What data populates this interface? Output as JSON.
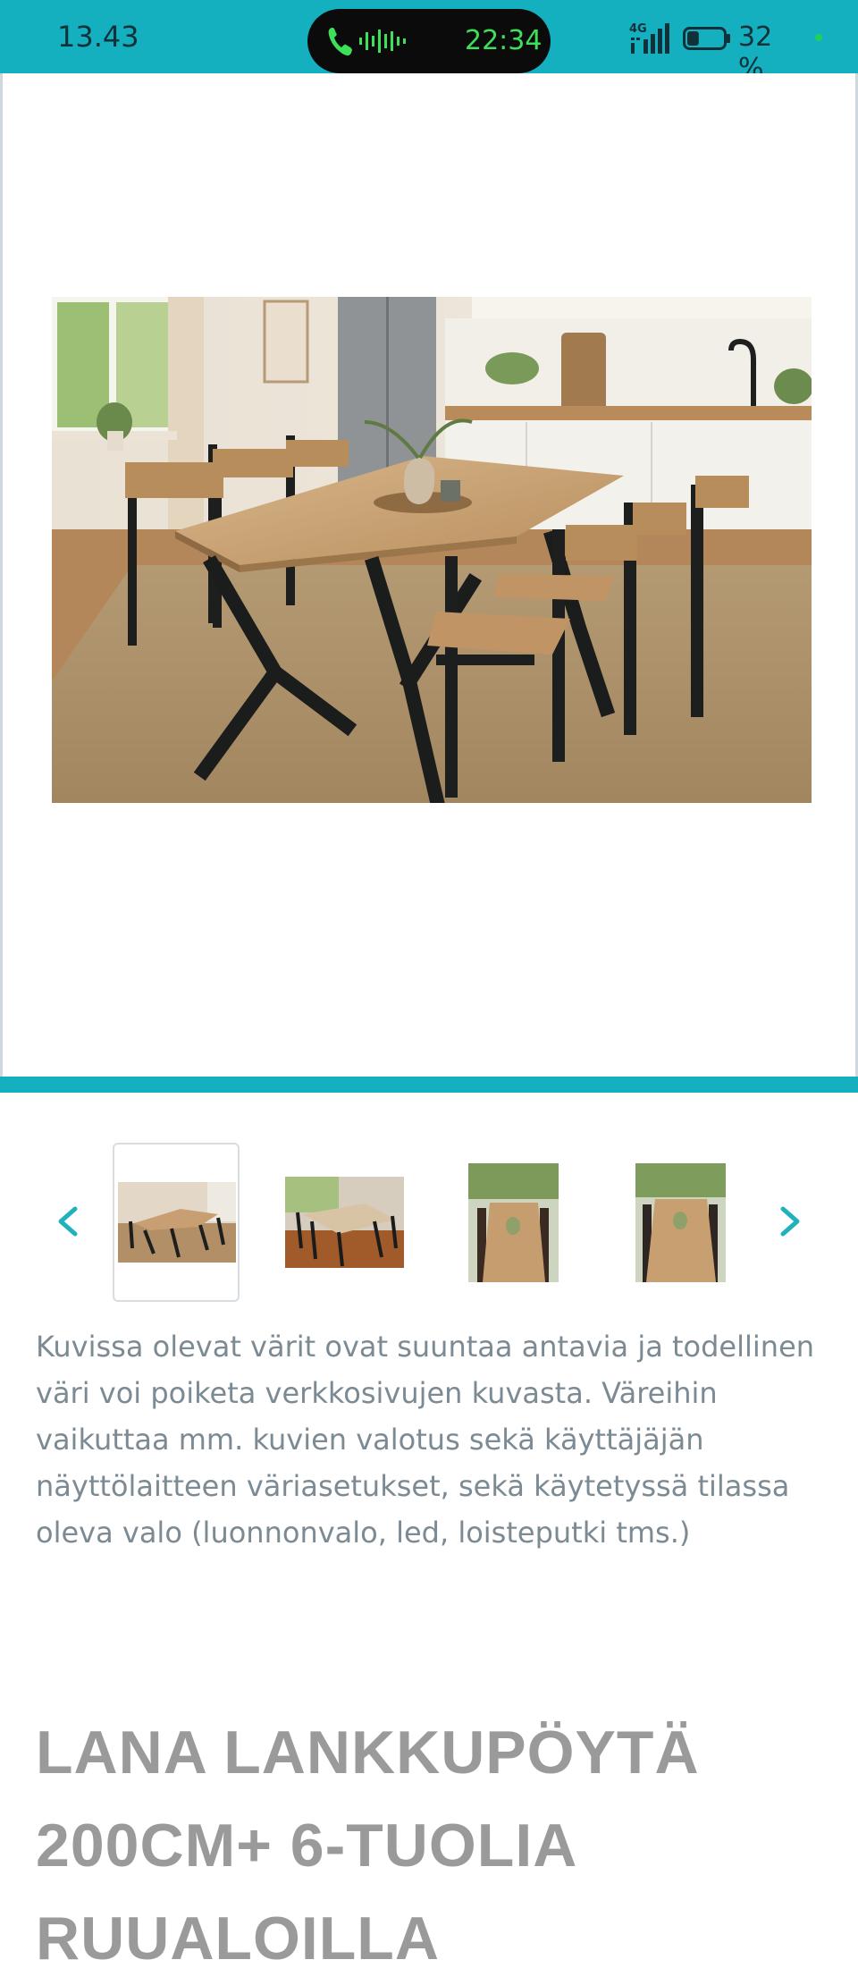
{
  "status_bar": {
    "time": "13.43",
    "call_timer": "22:34",
    "network": "4G",
    "battery_percent": "32 %",
    "battery_level": 0.32,
    "call_icon": "phone-icon",
    "audio_icon": "audio-wave-icon"
  },
  "gallery": {
    "main_image_alt": "dining-table-with-six-chairs-photo",
    "prev_icon": "chevron-left-icon",
    "next_icon": "chevron-right-icon",
    "selected_index": 0,
    "thumbnail_count": 4
  },
  "disclaimer": "Kuvissa olevat värit ovat suuntaa antavia ja todellinen väri voi poiketa verkkosivujen kuvasta. Väreihin vaikuttaa mm. kuvien valotus sekä käyttäjäjän näyttölaitteen väriasetukset, sekä käytetyssä tilassa oleva valo (luonnonvalo, led, loisteputki tms.)",
  "product": {
    "title": "LANA LANKKUPÖYTÄ 200CM+ 6-TUOLIA RUUALOILLA"
  },
  "colors": {
    "accent": "#14b0bf",
    "text_muted": "#7c8a94",
    "title": "#9a9a9a"
  }
}
